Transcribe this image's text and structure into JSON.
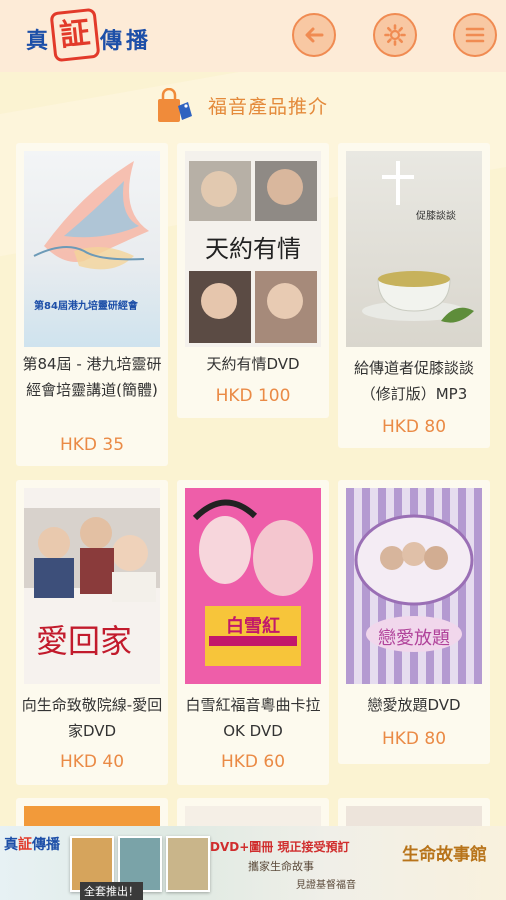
{
  "header": {
    "logo_chars": [
      "真",
      "証",
      "傳",
      "播"
    ],
    "back_icon": "arrow-left-icon",
    "settings_icon": "gear-icon",
    "menu_icon": "hamburger-menu-icon"
  },
  "section": {
    "title": "福音產品推介",
    "icon": "shopping-bag-icon"
  },
  "products": [
    {
      "title": "第84屆 - 港九培靈研經會培靈講道(簡體)",
      "price": "HKD 35",
      "cover_text": "第84屆港九培靈研經會"
    },
    {
      "title": "天約有情DVD",
      "price": "HKD 100",
      "cover_text": "天約有情"
    },
    {
      "title": "給傳道者促膝談談（修訂版）MP3",
      "price": "HKD 80",
      "cover_text": "促膝談談"
    },
    {
      "title": "向生命致敬院線-愛回家DVD",
      "price": "HKD 40",
      "cover_text": "愛回家"
    },
    {
      "title": "白雪紅福音粵曲卡拉OK DVD",
      "price": "HKD 60",
      "cover_text": "白雪紅"
    },
    {
      "title": "戀愛放題DVD",
      "price": "HKD 80",
      "cover_text": "戀愛放題"
    }
  ],
  "banner": {
    "logo_left": "真",
    "logo_mid": "証",
    "logo_right": "傳播",
    "line1": "DVD+圖冊 現正接受預訂",
    "line2": "攜家生命故事",
    "line3": "見證基督福音",
    "tag": "全套推出！",
    "right_title": "生命故事館"
  },
  "colors": {
    "background": "#fbf3d2",
    "header": "#fdebd7",
    "accent": "#ea8a45",
    "button_fill": "#f8c8a3"
  }
}
